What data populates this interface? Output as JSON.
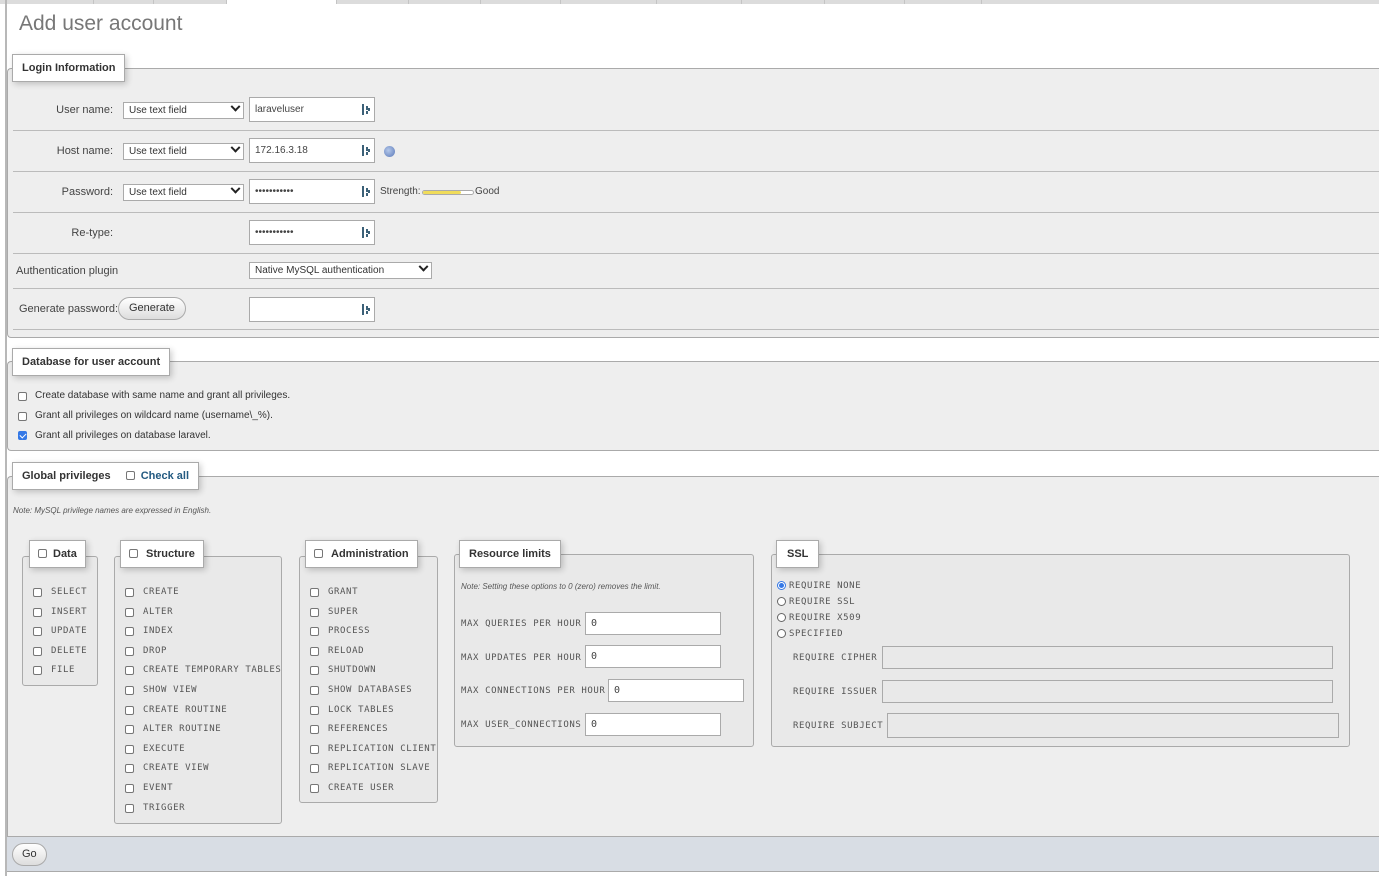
{
  "page_title": "Add user account",
  "login": {
    "legend": "Login Information",
    "user_name": {
      "label": "User name:",
      "mode": "Use text field",
      "value": "laraveluser"
    },
    "host_name": {
      "label": "Host name:",
      "mode": "Use text field",
      "value": "172.16.3.18"
    },
    "password": {
      "label": "Password:",
      "mode": "Use text field",
      "value": "•••••••••••",
      "strength_label": "Strength:",
      "strength_text": "Good",
      "strength_fraction": 0.75
    },
    "retype": {
      "label": "Re-type:",
      "value": "•••••••••••"
    },
    "auth_plugin": {
      "label": "Authentication plugin",
      "value": "Native MySQL authentication"
    },
    "generate": {
      "label": "Generate password:",
      "button": "Generate",
      "value": ""
    }
  },
  "database": {
    "legend": "Database for user account",
    "options": [
      {
        "label": "Create database with same name and grant all privileges.",
        "checked": false
      },
      {
        "label": "Grant all privileges on wildcard name (username\\_%).",
        "checked": false
      },
      {
        "label": "Grant all privileges on database laravel.",
        "checked": true
      }
    ]
  },
  "global": {
    "legend": "Global privileges",
    "check_all": "Check all",
    "note": "Note: MySQL privilege names are expressed in English.",
    "data": {
      "legend": "Data",
      "items": [
        "SELECT",
        "INSERT",
        "UPDATE",
        "DELETE",
        "FILE"
      ]
    },
    "structure": {
      "legend": "Structure",
      "items": [
        "CREATE",
        "ALTER",
        "INDEX",
        "DROP",
        "CREATE TEMPORARY TABLES",
        "SHOW VIEW",
        "CREATE ROUTINE",
        "ALTER ROUTINE",
        "EXECUTE",
        "CREATE VIEW",
        "EVENT",
        "TRIGGER"
      ]
    },
    "administration": {
      "legend": "Administration",
      "items": [
        "GRANT",
        "SUPER",
        "PROCESS",
        "RELOAD",
        "SHUTDOWN",
        "SHOW DATABASES",
        "LOCK TABLES",
        "REFERENCES",
        "REPLICATION CLIENT",
        "REPLICATION SLAVE",
        "CREATE USER"
      ]
    },
    "resource": {
      "legend": "Resource limits",
      "note": "Note: Setting these options to 0 (zero) removes the limit.",
      "fields": [
        {
          "label": "MAX QUERIES PER HOUR",
          "value": "0"
        },
        {
          "label": "MAX UPDATES PER HOUR",
          "value": "0"
        },
        {
          "label": "MAX CONNECTIONS PER HOUR",
          "value": "0"
        },
        {
          "label": "MAX USER_CONNECTIONS",
          "value": "0"
        }
      ]
    },
    "ssl": {
      "legend": "SSL",
      "options": [
        {
          "label": "REQUIRE NONE",
          "selected": true
        },
        {
          "label": "REQUIRE SSL",
          "selected": false
        },
        {
          "label": "REQUIRE X509",
          "selected": false
        },
        {
          "label": "SPECIFIED",
          "selected": false
        }
      ],
      "fields": [
        {
          "label": "REQUIRE CIPHER",
          "value": ""
        },
        {
          "label": "REQUIRE ISSUER",
          "value": ""
        },
        {
          "label": "REQUIRE SUBJECT",
          "value": ""
        }
      ]
    }
  },
  "footer": {
    "go": "Go"
  }
}
